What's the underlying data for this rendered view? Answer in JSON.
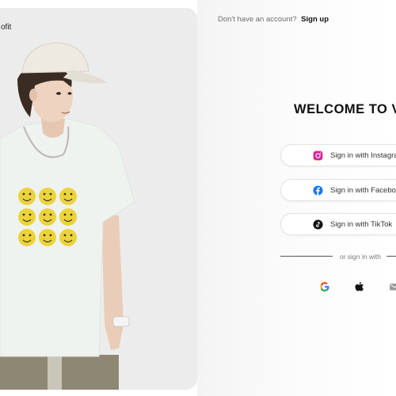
{
  "brand": {
    "logo_partial": "ofit"
  },
  "header": {
    "prompt": "Don't have an account?",
    "signup_label": "Sign up"
  },
  "welcome": {
    "title": "WELCOME TO VO"
  },
  "social": [
    {
      "label": "Sign in with Instagram",
      "icon": "instagram-icon"
    },
    {
      "label": "Sign in with Facebook",
      "icon": "facebook-icon"
    },
    {
      "label": "Sign in with TikTok",
      "icon": "tiktok-icon"
    }
  ],
  "alt_signin": {
    "label": "or sign in with",
    "icons": [
      "google-icon",
      "apple-icon",
      "email-icon"
    ]
  },
  "colors": {
    "instagram": "#d6249f",
    "facebook": "#1877f2",
    "tiktok": "#111111",
    "google_blue": "#4285f4",
    "google_red": "#ea4335",
    "google_yellow": "#fbbc05",
    "google_green": "#34a853"
  }
}
